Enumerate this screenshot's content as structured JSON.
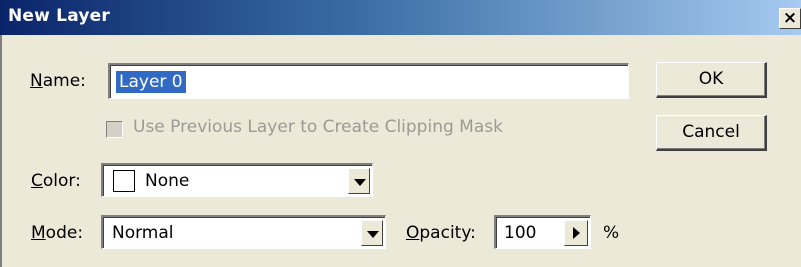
{
  "window": {
    "title": "New Layer",
    "close_glyph": "×"
  },
  "form": {
    "name_label_prefix": "N",
    "name_label_rest": "ame:",
    "name_value": "Layer 0",
    "clip_label": "Use Previous Layer to Create Clipping Mask",
    "clip_checked": false,
    "clip_enabled": false,
    "color_label_prefix": "C",
    "color_label_rest": "olor:",
    "color_value": "None",
    "mode_label_prefix": "M",
    "mode_label_rest": "ode:",
    "mode_value": "Normal",
    "opacity_label_prefix": "O",
    "opacity_label_rest": "pacity:",
    "opacity_value": "100",
    "opacity_unit": "%"
  },
  "buttons": {
    "ok_label": "OK",
    "cancel_label": "Cancel"
  },
  "colors": {
    "titlebar_start": "#0a246a",
    "selection": "#316ac5",
    "dialog_bg": "#ece9d8",
    "disabled_text": "#9c9a94"
  },
  "icons": {
    "close": "close-icon",
    "dropdown": "chevron-down-icon",
    "slider_popup": "triangle-right-icon"
  }
}
